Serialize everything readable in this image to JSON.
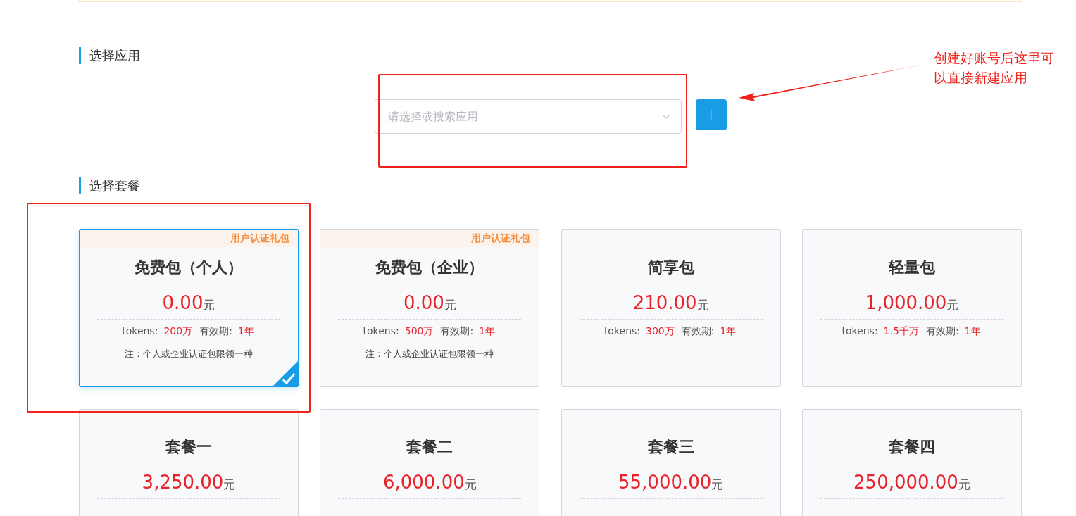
{
  "sections": [
    {
      "title": "选择应用"
    },
    {
      "title": "选择套餐"
    }
  ],
  "app_select": {
    "placeholder": "请选择或搜索应用"
  },
  "add_button": {
    "label": "+"
  },
  "annotation": {
    "text": "创建好账号后这里可以直接新建应用"
  },
  "packages": [
    {
      "badge": "用户认证礼包",
      "title": "免费包（个人）",
      "price": "0.00",
      "unit": "元",
      "tokens_label": "tokens:",
      "tokens": "200万",
      "validity_label": "有效期:",
      "validity": "1年",
      "note": "注：个人或企业认证包限领一种",
      "selected": true
    },
    {
      "badge": "用户认证礼包",
      "title": "免费包（企业）",
      "price": "0.00",
      "unit": "元",
      "tokens_label": "tokens:",
      "tokens": "500万",
      "validity_label": "有效期:",
      "validity": "1年",
      "note": "注：个人或企业认证包限领一种",
      "selected": false
    },
    {
      "title": "简享包",
      "price": "210.00",
      "unit": "元",
      "tokens_label": "tokens:",
      "tokens": "300万",
      "validity_label": "有效期:",
      "validity": "1年",
      "selected": false
    },
    {
      "title": "轻量包",
      "price": "1,000.00",
      "unit": "元",
      "tokens_label": "tokens:",
      "tokens": "1.5千万",
      "validity_label": "有效期:",
      "validity": "1年",
      "selected": false
    },
    {
      "title": "套餐一",
      "price": "3,250.00",
      "unit": "元",
      "selected": false
    },
    {
      "title": "套餐二",
      "price": "6,000.00",
      "unit": "元",
      "selected": false
    },
    {
      "title": "套餐三",
      "price": "55,000.00",
      "unit": "元",
      "selected": false
    },
    {
      "title": "套餐四",
      "price": "250,000.00",
      "unit": "元",
      "selected": false
    }
  ]
}
